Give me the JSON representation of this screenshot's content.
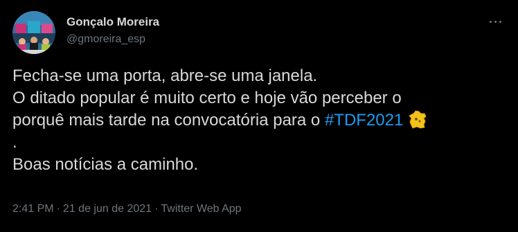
{
  "author": {
    "display_name": "Gonçalo Moreira",
    "handle": "@gmoreira_esp",
    "avatar_icon": "profile-photo"
  },
  "more_menu_icon": "more-options-icon",
  "tweet": {
    "line1": "Fecha-se uma porta, abre-se uma janela.",
    "line2": "O ditado popular é muito certo e hoje vão perceber o",
    "line3_text": "porquê mais tarde na convocatória para o ",
    "hashtag": "#TDF2021",
    "emoji_icon": "france-map-yellow-icon",
    "line4": ".",
    "line5": "Boas notícias a caminho."
  },
  "meta": {
    "time": "2:41 PM",
    "date": "21 de jun de 2021",
    "source": "Twitter Web App",
    "separator": "·"
  },
  "colors": {
    "background": "#000000",
    "text": "#d9d9d9",
    "secondary": "#6e767d",
    "link": "#1d9bf0"
  }
}
